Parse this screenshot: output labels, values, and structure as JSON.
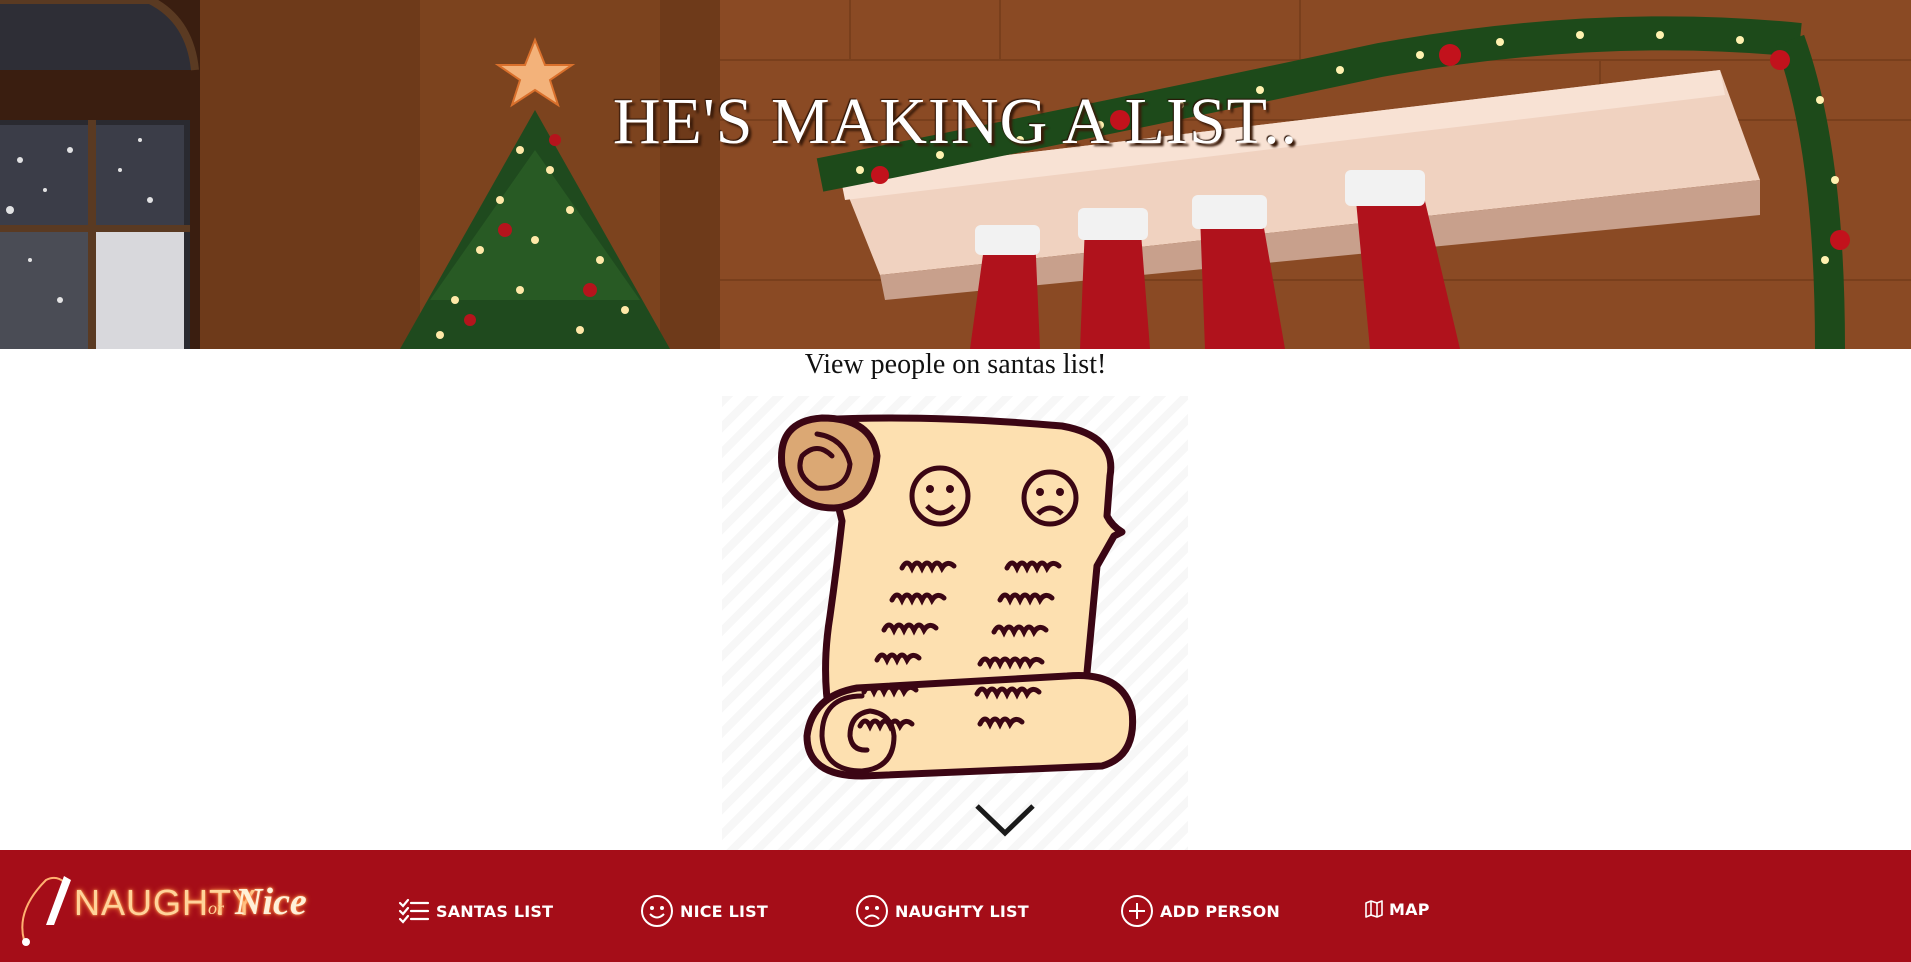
{
  "hero": {
    "title": "HE'S MAKING A LIST.."
  },
  "subtitle": "View people on santas list!",
  "scroll_image": {
    "icons": [
      "happy-face-icon",
      "sad-face-icon",
      "chevron-down-icon"
    ]
  },
  "logo": {
    "naughty": "NAUGHTY",
    "or": "or",
    "nice": "Nice"
  },
  "nav": {
    "santas_list": "SANTAS LIST",
    "nice_list": "NICE LIST",
    "naughty_list": "NAUGHTY LIST",
    "add_person": "ADD PERSON",
    "map": "MAP"
  },
  "colors": {
    "navbar": "#a50d18",
    "logo_glow": "#ff8a3a",
    "scroll_fill": "#fde0b0",
    "scroll_outline": "#3b0614"
  }
}
